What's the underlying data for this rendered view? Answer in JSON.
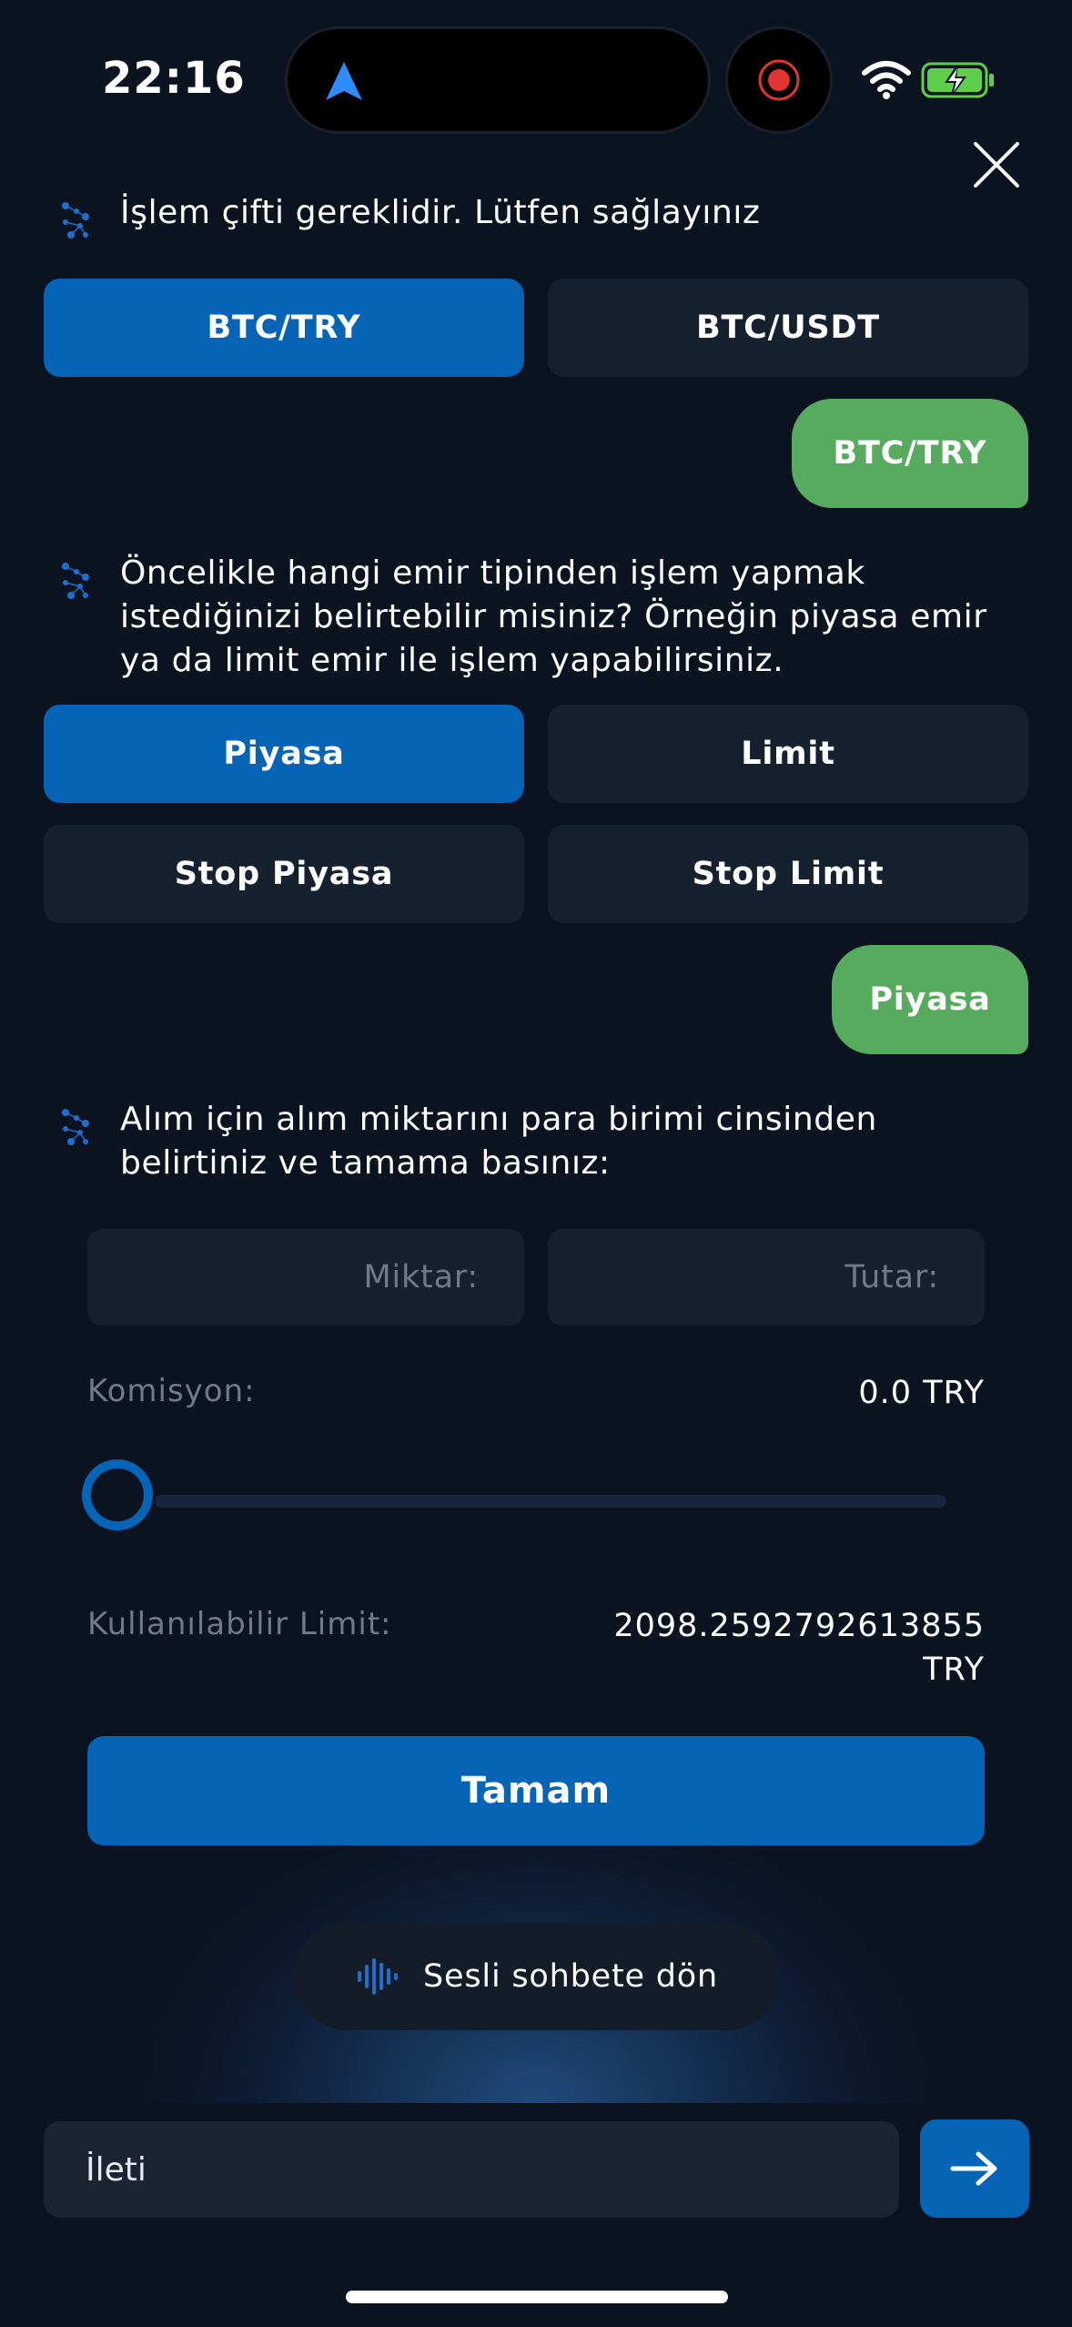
{
  "status_bar": {
    "time": "22:16"
  },
  "colors": {
    "primary": "#0564b5",
    "user_bubble": "#57ab5f",
    "option_bg": "#162130",
    "background": "#0b1220"
  },
  "icons": {
    "close": "close-icon",
    "bot": "bot-icon",
    "send": "arrow-right-icon",
    "voice": "waveform-icon"
  },
  "chat": {
    "q1": {
      "text": "İşlem çifti gereklidir. Lütfen sağlayınız"
    },
    "q1_options": [
      "BTC/TRY",
      "BTC/USDT"
    ],
    "q1_selected": "BTC/TRY",
    "a1": "BTC/TRY",
    "q2": {
      "lines": [
        "Öncelikle hangi emir tipinden işlem yapmak",
        "istediğinizi belirtebilir misiniz? Örneğin piyasa emir",
        "ya da limit emir ile işlem yapabilirsiniz."
      ]
    },
    "q2_options": [
      "Piyasa",
      "Limit",
      "Stop Piyasa",
      "Stop Limit"
    ],
    "q2_selected": "Piyasa",
    "a2": "Piyasa",
    "q3": {
      "lines": [
        "Alım için alım miktarını para birimi cinsinden",
        "belirtiniz ve tamama basınız:"
      ]
    }
  },
  "order_form": {
    "amount_placeholder": "Miktar:",
    "total_placeholder": "Tutar:",
    "commission_label": "Komisyon:",
    "commission_value": "0.0 TRY",
    "slider_value_percent": 0,
    "limit_label": "Kullanılabilir Limit:",
    "limit_value_line1": "2098.2592792613855",
    "limit_value_line2": "TRY",
    "confirm_label": "Tamam"
  },
  "voice_button": {
    "label": "Sesli sohbete dön"
  },
  "composer": {
    "placeholder": "İleti"
  }
}
